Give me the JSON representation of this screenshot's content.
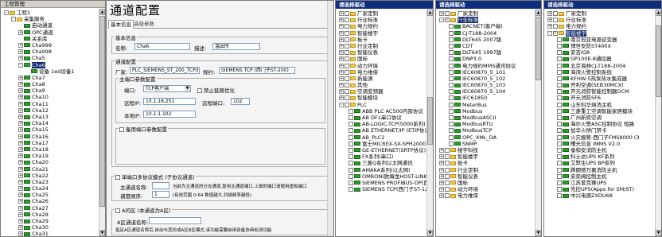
{
  "project_tree": {
    "title": "工程管理",
    "items": [
      {
        "label": "工程1",
        "level": 0,
        "exp": "-"
      },
      {
        "label": "采集服务",
        "level": 1,
        "exp": "-"
      },
      {
        "label": "启动通道",
        "level": 2,
        "exp": ""
      },
      {
        "label": "OPC通道",
        "level": 2,
        "exp": "+"
      },
      {
        "label": "关系库",
        "level": 2,
        "exp": ""
      },
      {
        "label": "Cha999",
        "level": 2,
        "exp": "+"
      },
      {
        "label": "Cha998",
        "level": 2,
        "exp": "+"
      },
      {
        "label": "Cha5",
        "level": 2,
        "exp": "+"
      },
      {
        "label": "Cha6",
        "level": 2,
        "exp": "-",
        "selected": true
      },
      {
        "label": "设备 1ed设备1",
        "level": 3,
        "exp": ""
      },
      {
        "label": "Cha7",
        "level": 2,
        "exp": "+"
      },
      {
        "label": "Cha8",
        "level": 2,
        "exp": "+"
      },
      {
        "label": "Cha9",
        "level": 2,
        "exp": "+"
      },
      {
        "label": "Cha10",
        "level": 2,
        "exp": "+"
      },
      {
        "label": "Cha11",
        "level": 2,
        "exp": "+"
      },
      {
        "label": "Cha12",
        "level": 2,
        "exp": "+"
      },
      {
        "label": "Cha13",
        "level": 2,
        "exp": "+"
      },
      {
        "label": "Cha14",
        "level": 2,
        "exp": "+"
      },
      {
        "label": "Cha15",
        "level": 2,
        "exp": "+"
      },
      {
        "label": "Cha16",
        "level": 2,
        "exp": "+"
      },
      {
        "label": "Cha17",
        "level": 2,
        "exp": "+"
      },
      {
        "label": "Cha18",
        "level": 2,
        "exp": "+"
      },
      {
        "label": "Cha19",
        "level": 2,
        "exp": "+"
      },
      {
        "label": "Cha20",
        "level": 2,
        "exp": "+"
      },
      {
        "label": "Cha21",
        "level": 2,
        "exp": "+"
      },
      {
        "label": "Cha22",
        "level": 2,
        "exp": "+"
      },
      {
        "label": "Cha23",
        "level": 2,
        "exp": "+"
      },
      {
        "label": "Cha24",
        "level": 2,
        "exp": "+"
      },
      {
        "label": "Cha25",
        "level": 2,
        "exp": "+"
      },
      {
        "label": "Cha26",
        "level": 2,
        "exp": "+"
      },
      {
        "label": "Cha27",
        "level": 2,
        "exp": "+"
      },
      {
        "label": "Cha28",
        "level": 2,
        "exp": "+"
      },
      {
        "label": "Cha29",
        "level": 2,
        "exp": "+"
      },
      {
        "label": "Cha30",
        "level": 2,
        "exp": "+"
      },
      {
        "label": "Cha31",
        "level": 2,
        "exp": "+"
      }
    ]
  },
  "config": {
    "title": "通道配置",
    "tabs": [
      "基本信息",
      "高级参数"
    ],
    "basic": {
      "group": "基本信息",
      "name_label": "名称:",
      "name_value": "Cha6",
      "desc_label": "描述:",
      "desc_value": "温出所"
    },
    "channel": {
      "group": "通道配置",
      "vendor_label": "厂家:",
      "vendor_value": "PLC_SIEMENS_ST_200_TCP/IL",
      "protocol_label": "规约:",
      "protocol_value": "SIEMENS TCP (西门子ST-200)"
    },
    "main_port": {
      "group": "主端口参数配置",
      "port_label": "端口:",
      "port_value": "TCP客户端",
      "disable_opt": "禁止链路优化",
      "remote_ip_label": "远程IP:",
      "remote_ip_value": "10.1.16.251",
      "remote_port_label": "远程端口:",
      "remote_port_value": "102",
      "local_ip_label": "本地IP:",
      "local_ip_value": "10.1.1.102"
    },
    "backup": {
      "group": "备用端口参数配置"
    },
    "single": {
      "group": "单端口多协议模式 (子协议通道)",
      "main_name_label": "主通道名称:",
      "main_name_hint": "当前为主通道的分支通道,复用主通道端口,上面的端口请使用虚拟端口",
      "seq_label": "调度顺序:",
      "seq_value": "1",
      "seq_hint": "(有效范围 0-64 数值越大,扫描频率越低)"
    },
    "a_mode": {
      "group": "A的区 (本通道为A区)",
      "a_name_label": "A区通道名称:",
      "hint": "指定A区通道名称后,自动与其形成A区B区模式,该功能需要启用设备协商检测功能"
    }
  },
  "driver1": {
    "title": "请选择驱动",
    "items": [
      {
        "label": "厂家定制",
        "exp": "+",
        "icon": "folder",
        "level": 0
      },
      {
        "label": "行业标准",
        "exp": "+",
        "icon": "folder",
        "level": 0
      },
      {
        "label": "电力规约",
        "exp": "+",
        "icon": "folder",
        "level": 0
      },
      {
        "label": "智能楼宇",
        "exp": "+",
        "icon": "folder",
        "level": 0
      },
      {
        "label": "板卡",
        "exp": "+",
        "icon": "folder",
        "level": 0
      },
      {
        "label": "行业定制",
        "exp": "+",
        "icon": "folder",
        "level": 0
      },
      {
        "label": "智能仪表",
        "exp": "+",
        "icon": "folder",
        "level": 0
      },
      {
        "label": "国标",
        "exp": "+",
        "icon": "folder",
        "level": 0
      },
      {
        "label": "动力环境",
        "exp": "+",
        "icon": "folder",
        "level": 0
      },
      {
        "label": "电力维保",
        "exp": "+",
        "icon": "folder",
        "level": 0
      },
      {
        "label": "新能源",
        "exp": "+",
        "icon": "folder",
        "level": 0
      },
      {
        "label": "其他",
        "exp": "+",
        "icon": "folder",
        "level": 0
      },
      {
        "label": "空调变频器",
        "exp": "+",
        "icon": "folder",
        "level": 0
      },
      {
        "label": "智能模块",
        "exp": "+",
        "icon": "folder",
        "level": 0
      },
      {
        "label": "PLC",
        "exp": "-",
        "icon": "folder",
        "level": 0
      },
      {
        "label": "ABB PLC AC500内部协议",
        "exp": "",
        "icon": "green",
        "level": 1
      },
      {
        "label": "AB DF1串口协议",
        "exp": "",
        "icon": "green",
        "level": 1
      },
      {
        "label": "AB-LOGIC-TCP(5000系列)",
        "exp": "",
        "icon": "green",
        "level": 1
      },
      {
        "label": "AB ETHERNET/IP (ETIP协议)",
        "exp": "",
        "icon": "green",
        "level": 1
      },
      {
        "label": "AB_PLC2",
        "exp": "",
        "icon": "green",
        "level": 1
      },
      {
        "label": "富士MICREX-SX-SPH2000",
        "exp": "",
        "icon": "green",
        "level": 1
      },
      {
        "label": "GE-ETHERNET(SRTP协议)",
        "exp": "",
        "icon": "green",
        "level": 1
      },
      {
        "label": "FX系列(串口)",
        "exp": "",
        "icon": "green",
        "level": 1
      },
      {
        "label": "三菱Q系列以太网通讯",
        "exp": "",
        "icon": "green",
        "level": 1
      },
      {
        "label": "AMAKA系列(以太网)",
        "exp": "",
        "icon": "green",
        "level": 1
      },
      {
        "label": "OMRON(欧姆龙HOST-LINK)",
        "exp": "",
        "icon": "green",
        "level": 1
      },
      {
        "label": "SIEMENS PROFIBUS-DP(西门",
        "exp": "",
        "icon": "green",
        "level": 1
      },
      {
        "label": "SIEMENS TCP(西门子ST-1200",
        "exp": "",
        "icon": "green",
        "level": 1
      }
    ]
  },
  "driver2": {
    "title": "请选择驱动",
    "items": [
      {
        "label": "厂家定制",
        "exp": "+",
        "icon": "folder",
        "level": 0
      },
      {
        "label": "行业标准",
        "exp": "-",
        "icon": "folder",
        "level": 0,
        "checked": true,
        "selected": true
      },
      {
        "label": "BACNET(客户端)",
        "exp": "",
        "icon": "green",
        "level": 1
      },
      {
        "label": "CJ-T188-2004",
        "exp": "",
        "icon": "green",
        "level": 1
      },
      {
        "label": "DLT645 2007版",
        "exp": "",
        "icon": "green",
        "level": 1
      },
      {
        "label": "CDT",
        "exp": "",
        "icon": "green",
        "level": 1
      },
      {
        "label": "DLT645 1997版",
        "exp": "",
        "icon": "green",
        "level": 1
      },
      {
        "label": "DNP3.0",
        "exp": "",
        "icon": "green",
        "level": 1
      },
      {
        "label": "电力规约MMS通讯协议",
        "exp": "",
        "icon": "green",
        "level": 1
      },
      {
        "label": "IEC60870_5_101",
        "exp": "",
        "icon": "green",
        "level": 1
      },
      {
        "label": "IEC60870_5_102",
        "exp": "",
        "icon": "green",
        "level": 1
      },
      {
        "label": "IEC60870_5_103",
        "exp": "",
        "icon": "green",
        "level": 1
      },
      {
        "label": "IEC60870_5_104",
        "exp": "",
        "icon": "green",
        "level": 1
      },
      {
        "label": "IEC61850",
        "exp": "",
        "icon": "green",
        "level": 1
      },
      {
        "label": "MeterBus",
        "exp": "",
        "icon": "green",
        "level": 1
      },
      {
        "label": "Modbus",
        "exp": "",
        "icon": "green",
        "level": 1
      },
      {
        "label": "ModbusASCII",
        "exp": "",
        "icon": "green",
        "level": 1
      },
      {
        "label": "ModbusRTU",
        "exp": "",
        "icon": "green",
        "level": 1
      },
      {
        "label": "ModbusTCP",
        "exp": "",
        "icon": "green",
        "level": 1
      },
      {
        "label": "OPC_XML_DA",
        "exp": "",
        "icon": "green",
        "level": 1
      },
      {
        "label": "SNMP",
        "exp": "",
        "icon": "green",
        "level": 1
      },
      {
        "label": "楼宇科技",
        "exp": "+",
        "icon": "folder",
        "level": 0
      },
      {
        "label": "智能楼宇",
        "exp": "+",
        "icon": "folder",
        "level": 0
      },
      {
        "label": "板卡",
        "exp": "+",
        "icon": "folder",
        "level": 0
      },
      {
        "label": "行业定制",
        "exp": "+",
        "icon": "folder",
        "level": 0
      },
      {
        "label": "智能仪表",
        "exp": "+",
        "icon": "folder",
        "level": 0
      },
      {
        "label": "国标",
        "exp": "+",
        "icon": "folder",
        "level": 0
      },
      {
        "label": "动力环境",
        "exp": "+",
        "icon": "folder",
        "level": 0
      },
      {
        "label": "电力维保",
        "exp": "+",
        "icon": "folder",
        "level": 0
      }
    ]
  },
  "driver3": {
    "title": "请选择驱动",
    "items": [
      {
        "label": "厂家定制",
        "exp": "+",
        "icon": "folder",
        "level": 0
      },
      {
        "label": "行业标准",
        "exp": "+",
        "icon": "folder",
        "level": 0
      },
      {
        "label": "电力规约",
        "exp": "+",
        "icon": "folder",
        "level": 0
      },
      {
        "label": "智能楼宇",
        "exp": "-",
        "icon": "folder",
        "level": 0,
        "checked": true,
        "selected": true
      },
      {
        "label": "南京冠亚电源逆变器",
        "exp": "",
        "icon": "green",
        "level": 1
      },
      {
        "label": "博世安防ST400X",
        "exp": "",
        "icon": "green",
        "level": 1
      },
      {
        "label": "安吉IQ8",
        "exp": "",
        "icon": "green",
        "level": 1
      },
      {
        "label": "GP100E-8通控器",
        "exp": "",
        "icon": "green",
        "level": 1
      },
      {
        "label": "北京海林CJ-T188-2004",
        "exp": "",
        "icon": "green",
        "level": 1
      },
      {
        "label": "海湾火警控制系统",
        "exp": "",
        "icon": "green",
        "level": 1
      },
      {
        "label": "KFHW-5热泵热水集成器",
        "exp": "",
        "icon": "green",
        "level": 1
      },
      {
        "label": "开利空调(SEB30MCX)",
        "exp": "",
        "icon": "green",
        "level": 1
      },
      {
        "label": "开元消防智能控制器OCM",
        "exp": "",
        "icon": "green",
        "level": 1
      },
      {
        "label": "开元消防SF6",
        "exp": "",
        "icon": "green",
        "level": 1
      },
      {
        "label": "山东科华熔消主机",
        "exp": "",
        "icon": "green",
        "level": 1
      },
      {
        "label": "三菱重工空调智能家居模块",
        "exp": "",
        "icon": "green",
        "level": 1
      },
      {
        "label": "广州新奕空调",
        "exp": "",
        "icon": "green",
        "level": 1
      },
      {
        "label": "海尔火警ASC控制协议 短路",
        "exp": "",
        "icon": "green",
        "level": 1
      },
      {
        "label": "加华火辨门禁卡",
        "exp": "",
        "icon": "green",
        "level": 1
      },
      {
        "label": "火灾报警-西门子FMS8000 (3",
        "exp": "",
        "icon": "green",
        "level": 1
      },
      {
        "label": "曙光信息 IMMS V2.0",
        "exp": "",
        "icon": "green",
        "level": 1
      },
      {
        "label": "泰和安消防主机",
        "exp": "",
        "icon": "green",
        "level": 1
      },
      {
        "label": "科士达UPS KF系列",
        "exp": "",
        "icon": "green",
        "level": 1
      },
      {
        "label": "艾默生UPS BP系列",
        "exp": "",
        "icon": "green",
        "level": 1
      },
      {
        "label": "腾朗德万嘉消防主机",
        "exp": "",
        "icon": "green",
        "level": 1
      },
      {
        "label": "安荣阀控制主机",
        "exp": "",
        "icon": "green",
        "level": 1
      },
      {
        "label": "江苏爱克赛UPS",
        "exp": "",
        "icon": "green",
        "level": 1
      },
      {
        "label": "先控UPS(Apps for SM/ST)",
        "exp": "",
        "icon": "green",
        "level": 1
      },
      {
        "label": "中兴电源ZXDU68",
        "exp": "",
        "icon": "green",
        "level": 1
      }
    ]
  }
}
